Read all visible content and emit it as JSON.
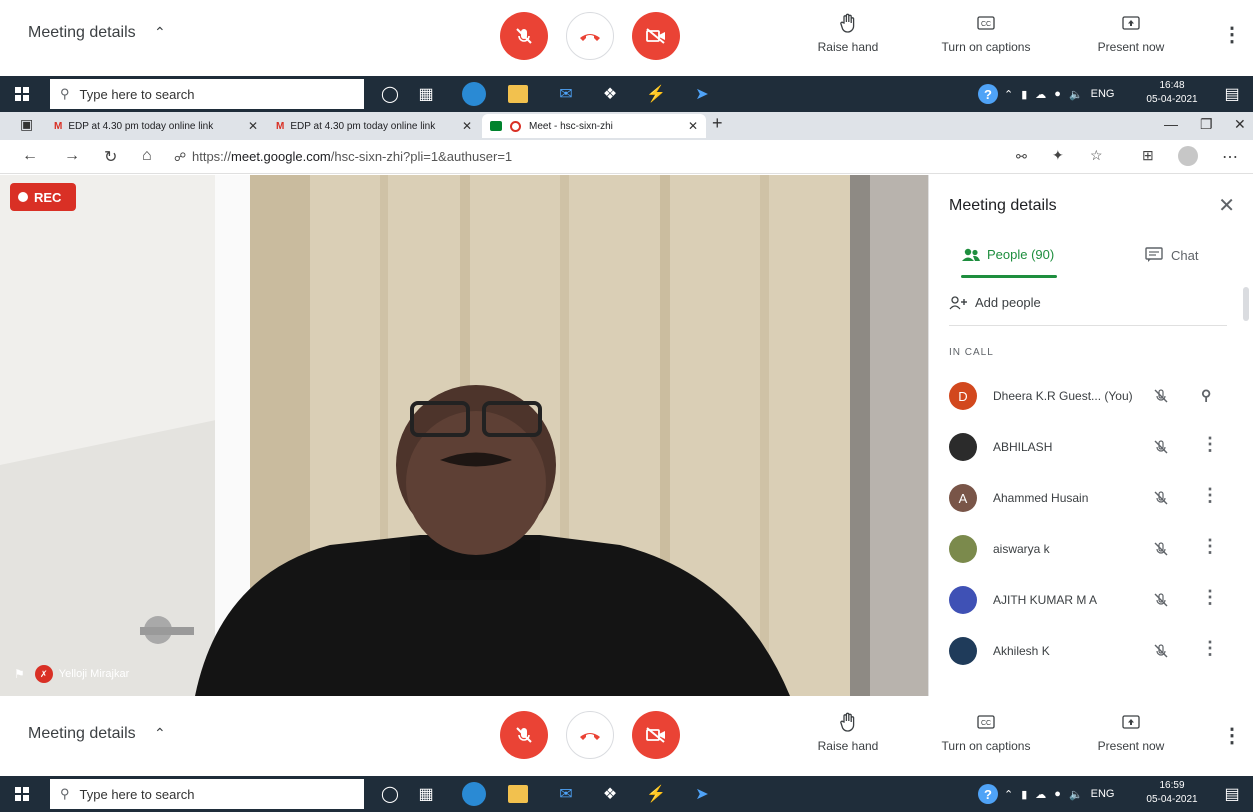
{
  "meet_bar": {
    "meeting_details": "Meeting details",
    "raise_hand": "Raise hand",
    "captions": "Turn on captions",
    "present": "Present now"
  },
  "taskbar_top": {
    "search_placeholder": "Type here to search",
    "lang": "ENG",
    "time": "16:48",
    "date": "05-04-2021"
  },
  "taskbar_bottom": {
    "search_placeholder": "Type here to search",
    "lang": "ENG",
    "time": "16:59",
    "date": "05-04-2021"
  },
  "browser": {
    "tabs": [
      {
        "title": "EDP at 4.30 pm today online link"
      },
      {
        "title": "EDP at 4.30 pm today online link"
      },
      {
        "title": "Meet - hsc-sixn-zhi"
      }
    ],
    "url_prefix": "https://",
    "url_host": "meet.google.com",
    "url_path": "/hsc-sixn-zhi?pli=1&authuser=1"
  },
  "video": {
    "rec_label": "REC",
    "speaker_name": "Yelloji Mirajkar"
  },
  "panel": {
    "title": "Meeting details",
    "tab_people": "People (90)",
    "tab_chat": "Chat",
    "add_people": "Add people",
    "in_call": "IN CALL",
    "participants": [
      {
        "name": "Dheera K.R Guest... (You)",
        "initial": "D",
        "color": "#d2481e"
      },
      {
        "name": "ABHILASH",
        "initial": "",
        "color": "#2b2b2b"
      },
      {
        "name": "Ahammed Husain",
        "initial": "A",
        "color": "#795548"
      },
      {
        "name": "aiswarya k",
        "initial": "",
        "color": "#7b8a4c"
      },
      {
        "name": "AJITH KUMAR M A",
        "initial": "",
        "color": "#3f51b5"
      },
      {
        "name": "Akhilesh K",
        "initial": "",
        "color": "#1f3b5a"
      }
    ]
  }
}
